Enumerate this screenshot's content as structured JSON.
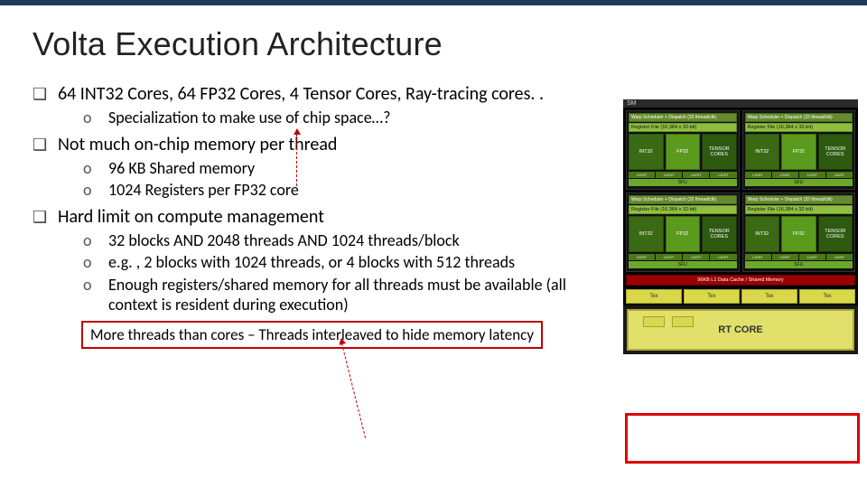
{
  "title": "Volta Execution Architecture",
  "bullets": [
    {
      "text": "64 INT32 Cores, 64 FP32 Cores, 4 Tensor Cores, Ray-tracing cores. .",
      "subs": [
        "Specialization to make use of chip space…?"
      ]
    },
    {
      "text": "Not much on-chip memory per thread",
      "subs": [
        "96 KB Shared memory",
        "1024 Registers per FP32 core"
      ]
    },
    {
      "text": "Hard limit on compute management",
      "subs": [
        "32 blocks AND 2048 threads AND 1024 threads/block",
        "e.g. , 2 blocks with 1024 threads, or 4 blocks with 512 threads",
        "Enough registers/shared memory for all threads must be available (all context is resident during execution)"
      ]
    }
  ],
  "callout": "More threads than cores – Threads interleaved to hide memory latency",
  "diagram": {
    "sm_label": "SM",
    "warp_label": "Warp Scheduler + Dispatch (32 thread/clk)",
    "regfile_label": "Register File (16,384 x 32-bit)",
    "core_labels": {
      "int32": "INT32",
      "fp32": "FP32",
      "tensor": "TENSOR CORES"
    },
    "ldst_label": "LD/ST",
    "sfu_label": "SFU",
    "mem_label": "96KB L1 Data Cache / Shared Memory",
    "tex_label": "Tex",
    "rt_label": "RT CORE"
  }
}
